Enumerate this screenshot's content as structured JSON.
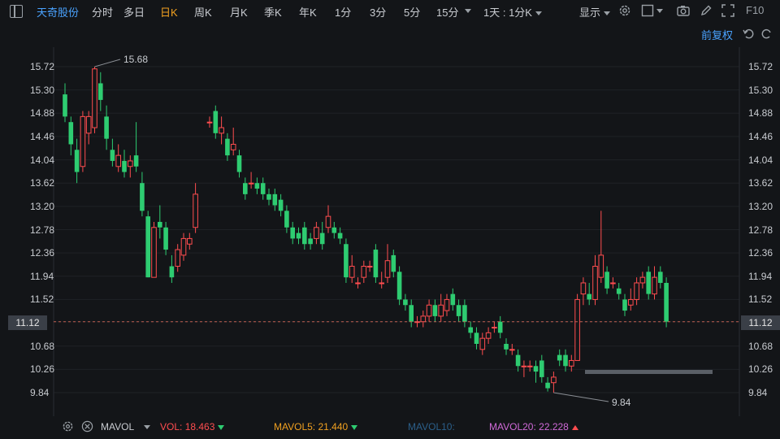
{
  "toolbar": {
    "stock_name": "天奇股份",
    "periods": [
      "分时",
      "多日",
      "日K",
      "周K",
      "月K",
      "季K",
      "年K",
      "1分",
      "3分",
      "5分",
      "15分"
    ],
    "active_period": "日K",
    "interval_select": "1天 : 1分K",
    "display_label": "显示",
    "right_tag": "F10"
  },
  "adjust_label": "前复权",
  "price_axis": [
    "15.72",
    "15.30",
    "14.88",
    "14.46",
    "14.04",
    "13.62",
    "13.20",
    "12.78",
    "12.36",
    "11.94",
    "11.52",
    "11.12",
    "10.68",
    "10.26",
    "9.84"
  ],
  "current_price": "11.12",
  "annotations": {
    "high": "15.68",
    "low": "9.84"
  },
  "colors": {
    "up": "#ff4d4f",
    "down": "#2ecc71",
    "stock": "#4aa3ff",
    "active": "#f0a020"
  },
  "indicator_bar": {
    "name": "MAVOL",
    "vol_label": "VOL:",
    "vol_value": "18.463",
    "mavol5_label": "MAVOL5:",
    "mavol5_value": "21.440",
    "mavol10_label": "MAVOL10:",
    "mavol20_label": "MAVOL20:",
    "mavol20_value": "22.228"
  },
  "chart_data": {
    "type": "candlestick",
    "y_range": [
      9.6,
      15.95
    ],
    "candles": [
      {
        "o": 15.22,
        "c": 14.82,
        "h": 15.42,
        "l": 14.72
      },
      {
        "o": 14.72,
        "c": 14.32,
        "h": 14.82,
        "l": 14.12
      },
      {
        "o": 14.22,
        "c": 13.82,
        "h": 14.42,
        "l": 13.62
      },
      {
        "o": 13.92,
        "c": 14.82,
        "h": 14.92,
        "l": 13.82
      },
      {
        "o": 14.52,
        "c": 14.82,
        "h": 14.92,
        "l": 14.32
      },
      {
        "o": 14.62,
        "c": 15.68,
        "h": 15.72,
        "l": 14.52
      },
      {
        "o": 15.42,
        "c": 15.12,
        "h": 15.62,
        "l": 14.92
      },
      {
        "o": 14.82,
        "c": 14.42,
        "h": 15.02,
        "l": 14.22
      },
      {
        "o": 14.22,
        "c": 14.02,
        "h": 14.42,
        "l": 13.92
      },
      {
        "o": 13.92,
        "c": 14.12,
        "h": 14.32,
        "l": 13.82
      },
      {
        "o": 14.02,
        "c": 13.82,
        "h": 14.22,
        "l": 13.72
      },
      {
        "o": 13.92,
        "c": 14.02,
        "h": 14.12,
        "l": 13.72
      },
      {
        "o": 14.12,
        "c": 13.92,
        "h": 14.72,
        "l": 13.82
      },
      {
        "o": 13.62,
        "c": 13.12,
        "h": 13.82,
        "l": 13.02
      },
      {
        "o": 13.02,
        "c": 11.92,
        "h": 13.12,
        "l": 11.92
      },
      {
        "o": 11.92,
        "c": 12.82,
        "h": 12.92,
        "l": 11.92
      },
      {
        "o": 12.92,
        "c": 12.82,
        "h": 13.22,
        "l": 12.62
      },
      {
        "o": 12.82,
        "c": 12.42,
        "h": 12.92,
        "l": 12.32
      },
      {
        "o": 12.12,
        "c": 11.92,
        "h": 12.32,
        "l": 11.82
      },
      {
        "o": 12.12,
        "c": 12.42,
        "h": 12.52,
        "l": 12.02
      },
      {
        "o": 12.32,
        "c": 12.62,
        "h": 12.72,
        "l": 12.22
      },
      {
        "o": 12.52,
        "c": 12.62,
        "h": 12.72,
        "l": 12.42
      },
      {
        "o": 12.82,
        "c": 13.42,
        "h": 13.62,
        "l": 12.72
      },
      {
        "o": 14.72,
        "c": 14.72,
        "h": 14.82,
        "l": 14.62
      },
      {
        "o": 14.92,
        "c": 14.52,
        "h": 15.02,
        "l": 14.42
      },
      {
        "o": 14.52,
        "c": 14.62,
        "h": 14.82,
        "l": 14.32
      },
      {
        "o": 14.42,
        "c": 14.12,
        "h": 14.52,
        "l": 14.02
      },
      {
        "o": 14.22,
        "c": 14.32,
        "h": 14.62,
        "l": 14.12
      },
      {
        "o": 14.12,
        "c": 13.82,
        "h": 14.22,
        "l": 13.72
      },
      {
        "o": 13.62,
        "c": 13.42,
        "h": 13.72,
        "l": 13.32
      },
      {
        "o": 13.62,
        "c": 13.62,
        "h": 13.82,
        "l": 13.52
      },
      {
        "o": 13.62,
        "c": 13.52,
        "h": 13.72,
        "l": 13.42
      },
      {
        "o": 13.62,
        "c": 13.42,
        "h": 13.72,
        "l": 13.32
      },
      {
        "o": 13.42,
        "c": 13.32,
        "h": 13.52,
        "l": 13.22
      },
      {
        "o": 13.42,
        "c": 13.22,
        "h": 13.52,
        "l": 13.12
      },
      {
        "o": 13.32,
        "c": 13.12,
        "h": 13.42,
        "l": 13.02
      },
      {
        "o": 13.12,
        "c": 12.82,
        "h": 13.22,
        "l": 12.72
      },
      {
        "o": 12.82,
        "c": 12.62,
        "h": 12.92,
        "l": 12.52
      },
      {
        "o": 12.72,
        "c": 12.62,
        "h": 12.82,
        "l": 12.52
      },
      {
        "o": 12.82,
        "c": 12.52,
        "h": 12.92,
        "l": 12.42
      },
      {
        "o": 12.62,
        "c": 12.52,
        "h": 12.72,
        "l": 12.42
      },
      {
        "o": 12.62,
        "c": 12.82,
        "h": 12.92,
        "l": 12.52
      },
      {
        "o": 12.72,
        "c": 12.52,
        "h": 12.92,
        "l": 12.42
      },
      {
        "o": 12.82,
        "c": 13.02,
        "h": 13.22,
        "l": 12.72
      },
      {
        "o": 12.82,
        "c": 12.72,
        "h": 12.92,
        "l": 12.62
      },
      {
        "o": 12.72,
        "c": 12.62,
        "h": 12.82,
        "l": 12.52
      },
      {
        "o": 12.52,
        "c": 11.92,
        "h": 12.62,
        "l": 11.82
      },
      {
        "o": 11.92,
        "c": 12.12,
        "h": 12.32,
        "l": 11.82
      },
      {
        "o": 11.82,
        "c": 11.82,
        "h": 11.92,
        "l": 11.72
      },
      {
        "o": 11.92,
        "c": 12.12,
        "h": 12.22,
        "l": 11.82
      },
      {
        "o": 12.12,
        "c": 12.12,
        "h": 12.22,
        "l": 12.02
      },
      {
        "o": 12.42,
        "c": 11.92,
        "h": 12.52,
        "l": 11.82
      },
      {
        "o": 11.82,
        "c": 11.82,
        "h": 12.02,
        "l": 11.72
      },
      {
        "o": 11.92,
        "c": 12.22,
        "h": 12.52,
        "l": 11.82
      },
      {
        "o": 12.32,
        "c": 12.02,
        "h": 12.42,
        "l": 11.92
      },
      {
        "o": 12.02,
        "c": 11.52,
        "h": 12.12,
        "l": 11.42
      },
      {
        "o": 11.52,
        "c": 11.42,
        "h": 11.62,
        "l": 11.32
      },
      {
        "o": 11.42,
        "c": 11.12,
        "h": 11.52,
        "l": 11.02
      },
      {
        "o": 11.12,
        "c": 11.12,
        "h": 11.22,
        "l": 11.02
      },
      {
        "o": 11.12,
        "c": 11.22,
        "h": 11.32,
        "l": 11.02
      },
      {
        "o": 11.22,
        "c": 11.42,
        "h": 11.52,
        "l": 11.12
      },
      {
        "o": 11.42,
        "c": 11.22,
        "h": 11.52,
        "l": 11.12
      },
      {
        "o": 11.22,
        "c": 11.42,
        "h": 11.62,
        "l": 11.12
      },
      {
        "o": 11.32,
        "c": 11.52,
        "h": 11.62,
        "l": 11.22
      },
      {
        "o": 11.62,
        "c": 11.42,
        "h": 11.72,
        "l": 11.32
      },
      {
        "o": 11.42,
        "c": 11.22,
        "h": 11.52,
        "l": 11.12
      },
      {
        "o": 11.42,
        "c": 11.12,
        "h": 11.52,
        "l": 11.02
      },
      {
        "o": 11.02,
        "c": 10.92,
        "h": 11.12,
        "l": 10.82
      },
      {
        "o": 10.92,
        "c": 10.72,
        "h": 11.02,
        "l": 10.62
      },
      {
        "o": 10.62,
        "c": 10.82,
        "h": 10.92,
        "l": 10.52
      },
      {
        "o": 10.82,
        "c": 10.92,
        "h": 11.02,
        "l": 10.72
      },
      {
        "o": 11.02,
        "c": 11.02,
        "h": 11.12,
        "l": 10.92
      },
      {
        "o": 11.12,
        "c": 10.92,
        "h": 11.22,
        "l": 10.82
      },
      {
        "o": 10.72,
        "c": 10.62,
        "h": 10.82,
        "l": 10.52
      },
      {
        "o": 10.62,
        "c": 10.62,
        "h": 10.72,
        "l": 10.52
      },
      {
        "o": 10.52,
        "c": 10.32,
        "h": 10.62,
        "l": 10.22
      },
      {
        "o": 10.32,
        "c": 10.32,
        "h": 10.42,
        "l": 10.12
      },
      {
        "o": 10.32,
        "c": 10.32,
        "h": 10.42,
        "l": 10.22
      },
      {
        "o": 10.32,
        "c": 10.22,
        "h": 10.42,
        "l": 10.02
      },
      {
        "o": 10.42,
        "c": 10.12,
        "h": 10.52,
        "l": 10.02
      },
      {
        "o": 10.02,
        "c": 9.92,
        "h": 10.12,
        "l": 9.86
      },
      {
        "o": 10.02,
        "c": 10.12,
        "h": 10.22,
        "l": 9.84
      },
      {
        "o": 10.52,
        "c": 10.42,
        "h": 10.62,
        "l": 10.32
      },
      {
        "o": 10.52,
        "c": 10.32,
        "h": 10.62,
        "l": 10.22
      },
      {
        "o": 10.32,
        "c": 10.42,
        "h": 10.52,
        "l": 10.22
      },
      {
        "o": 10.42,
        "c": 11.52,
        "h": 11.62,
        "l": 10.42
      },
      {
        "o": 11.62,
        "c": 11.82,
        "h": 11.92,
        "l": 11.42
      },
      {
        "o": 11.62,
        "c": 11.52,
        "h": 11.82,
        "l": 11.42
      },
      {
        "o": 11.52,
        "c": 12.12,
        "h": 12.32,
        "l": 11.42
      },
      {
        "o": 11.92,
        "c": 12.32,
        "h": 13.12,
        "l": 11.82
      },
      {
        "o": 12.02,
        "c": 11.72,
        "h": 12.12,
        "l": 11.62
      },
      {
        "o": 11.82,
        "c": 11.82,
        "h": 11.92,
        "l": 11.72
      },
      {
        "o": 11.72,
        "c": 11.62,
        "h": 11.82,
        "l": 11.52
      },
      {
        "o": 11.52,
        "c": 11.32,
        "h": 11.62,
        "l": 11.22
      },
      {
        "o": 11.42,
        "c": 11.52,
        "h": 11.72,
        "l": 11.32
      },
      {
        "o": 11.52,
        "c": 11.82,
        "h": 11.92,
        "l": 11.42
      },
      {
        "o": 11.82,
        "c": 11.92,
        "h": 12.02,
        "l": 11.72
      },
      {
        "o": 12.02,
        "c": 11.62,
        "h": 12.12,
        "l": 11.52
      },
      {
        "o": 11.62,
        "c": 11.92,
        "h": 12.12,
        "l": 11.52
      },
      {
        "o": 12.02,
        "c": 11.82,
        "h": 12.12,
        "l": 11.72
      },
      {
        "o": 11.82,
        "c": 11.12,
        "h": 11.92,
        "l": 11.02
      }
    ]
  }
}
